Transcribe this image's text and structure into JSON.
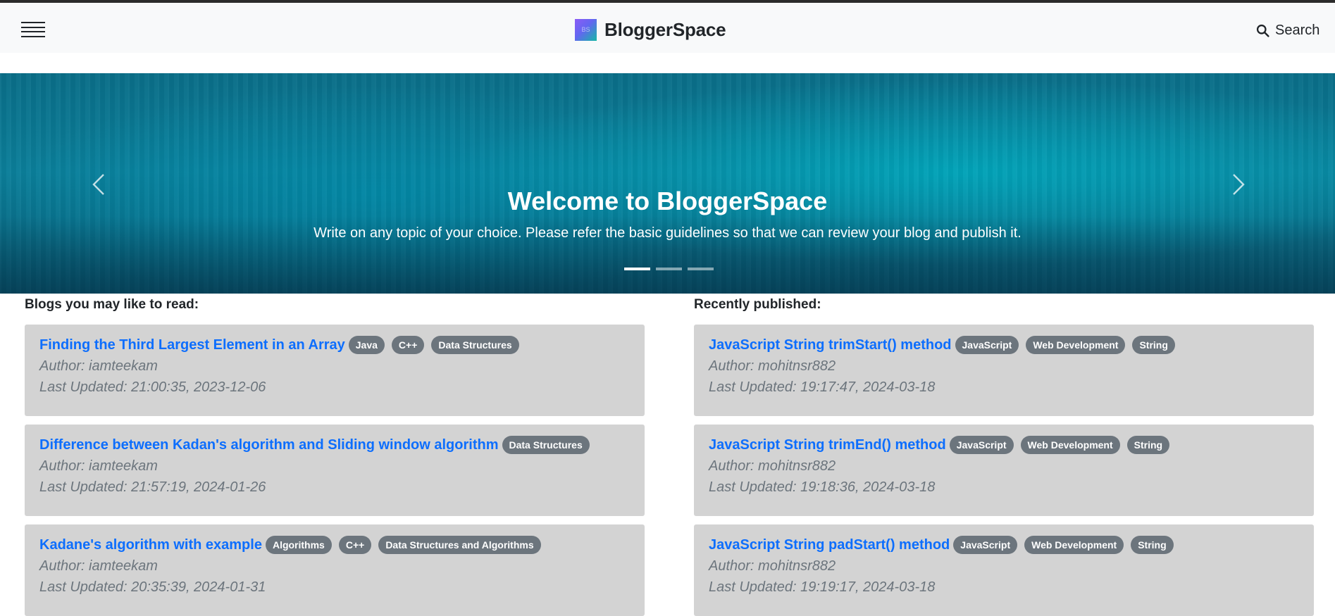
{
  "brand": {
    "name": "BloggerSpace",
    "logo_initials": "BS"
  },
  "nav": {
    "menu_icon": "hamburger-icon",
    "search_label": "Search",
    "search_icon": "search-icon"
  },
  "hero": {
    "title": "Welcome to BloggerSpace",
    "text": "Write on any topic of your choice. Please refer the basic guidelines so that we can review your blog and publish it.",
    "slide_count": 3,
    "active_slide": 1
  },
  "left": {
    "heading": "Blogs you may like to read:",
    "cards": [
      {
        "title": "Finding the Third Largest Element in an Array",
        "tags": [
          "Java",
          "C++",
          "Data Structures"
        ],
        "author": "Author: iamteekam",
        "updated": "Last Updated: 21:00:35, 2023-12-06"
      },
      {
        "title": "Difference between Kadan's algorithm and Sliding window algorithm",
        "tags": [
          "Data Structures"
        ],
        "author": "Author: iamteekam",
        "updated": "Last Updated: 21:57:19, 2024-01-26"
      },
      {
        "title": "Kadane's algorithm with example",
        "tags": [
          "Algorithms",
          "C++",
          "Data Structures and Algorithms"
        ],
        "author": "Author: iamteekam",
        "updated": "Last Updated: 20:35:39, 2024-01-31"
      }
    ]
  },
  "right": {
    "heading": "Recently published:",
    "cards": [
      {
        "title": "JavaScript String trimStart() method",
        "tags": [
          "JavaScript",
          "Web Development",
          "String"
        ],
        "author": "Author: mohitnsr882",
        "updated": "Last Updated: 19:17:47, 2024-03-18"
      },
      {
        "title": "JavaScript String trimEnd() method",
        "tags": [
          "JavaScript",
          "Web Development",
          "String"
        ],
        "author": "Author: mohitnsr882",
        "updated": "Last Updated: 19:18:36, 2024-03-18"
      },
      {
        "title": "JavaScript String padStart() method",
        "tags": [
          "JavaScript",
          "Web Development",
          "String"
        ],
        "author": "Author: mohitnsr882",
        "updated": "Last Updated: 19:19:17, 2024-03-18"
      }
    ]
  }
}
